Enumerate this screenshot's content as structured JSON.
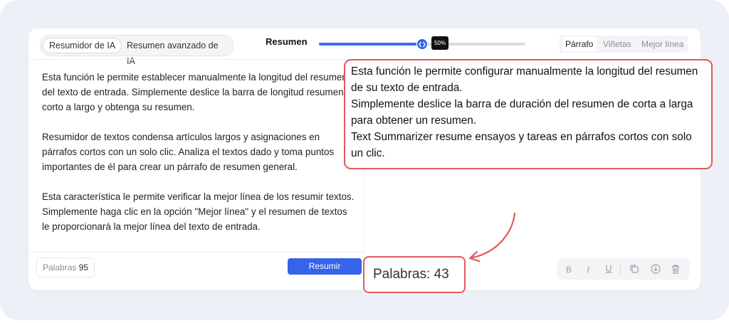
{
  "mode_tabs": {
    "basic": "Resumidor de IA",
    "advanced": "Resumen avanzado de IA"
  },
  "length": {
    "label": "Resumen",
    "value_pct": 50,
    "value_text": "50%"
  },
  "format_tabs": {
    "paragraph": "Párrafo",
    "bullets": "Viñetas",
    "best_line": "Mejor línea"
  },
  "input": {
    "paragraphs": [
      "Esta función le permite establecer manualmente la longitud del resumen del texto de entrada. Simplemente deslice la barra de longitud resumen corto a largo y obtenga su resumen.",
      "Resumidor de textos condensa artículos largos y asignaciones en párrafos cortos con un solo clic. Analiza el textos dado y toma puntos importantes de él para crear un párrafo de resumen general.",
      "Esta característica le permite verificar la mejor línea de los resumir textos. Simplemente haga clic en la opción \"Mejor línea\" y el resumen de textos le proporcionará la mejor línea del texto de entrada."
    ],
    "word_count_label": "Palabras",
    "word_count": "95"
  },
  "summarize_button": "Resumir",
  "output": {
    "lines": [
      "Esta función le permite configurar manualmente la longitud del resumen de su texto de entrada.",
      "Simplemente deslice la barra de duración del resumen de corta a larga para obtener un resumen.",
      "Text Summarizer resume ensayos y tareas en párrafos cortos con solo un clic."
    ],
    "word_count_text": "Palabras: 43"
  },
  "toolbar_icons": [
    "bold-icon",
    "italic-icon",
    "underline-icon",
    "copy-icon",
    "download-icon",
    "trash-icon"
  ],
  "colors": {
    "accent": "#3563e9",
    "highlight_border": "#e25a5a"
  }
}
